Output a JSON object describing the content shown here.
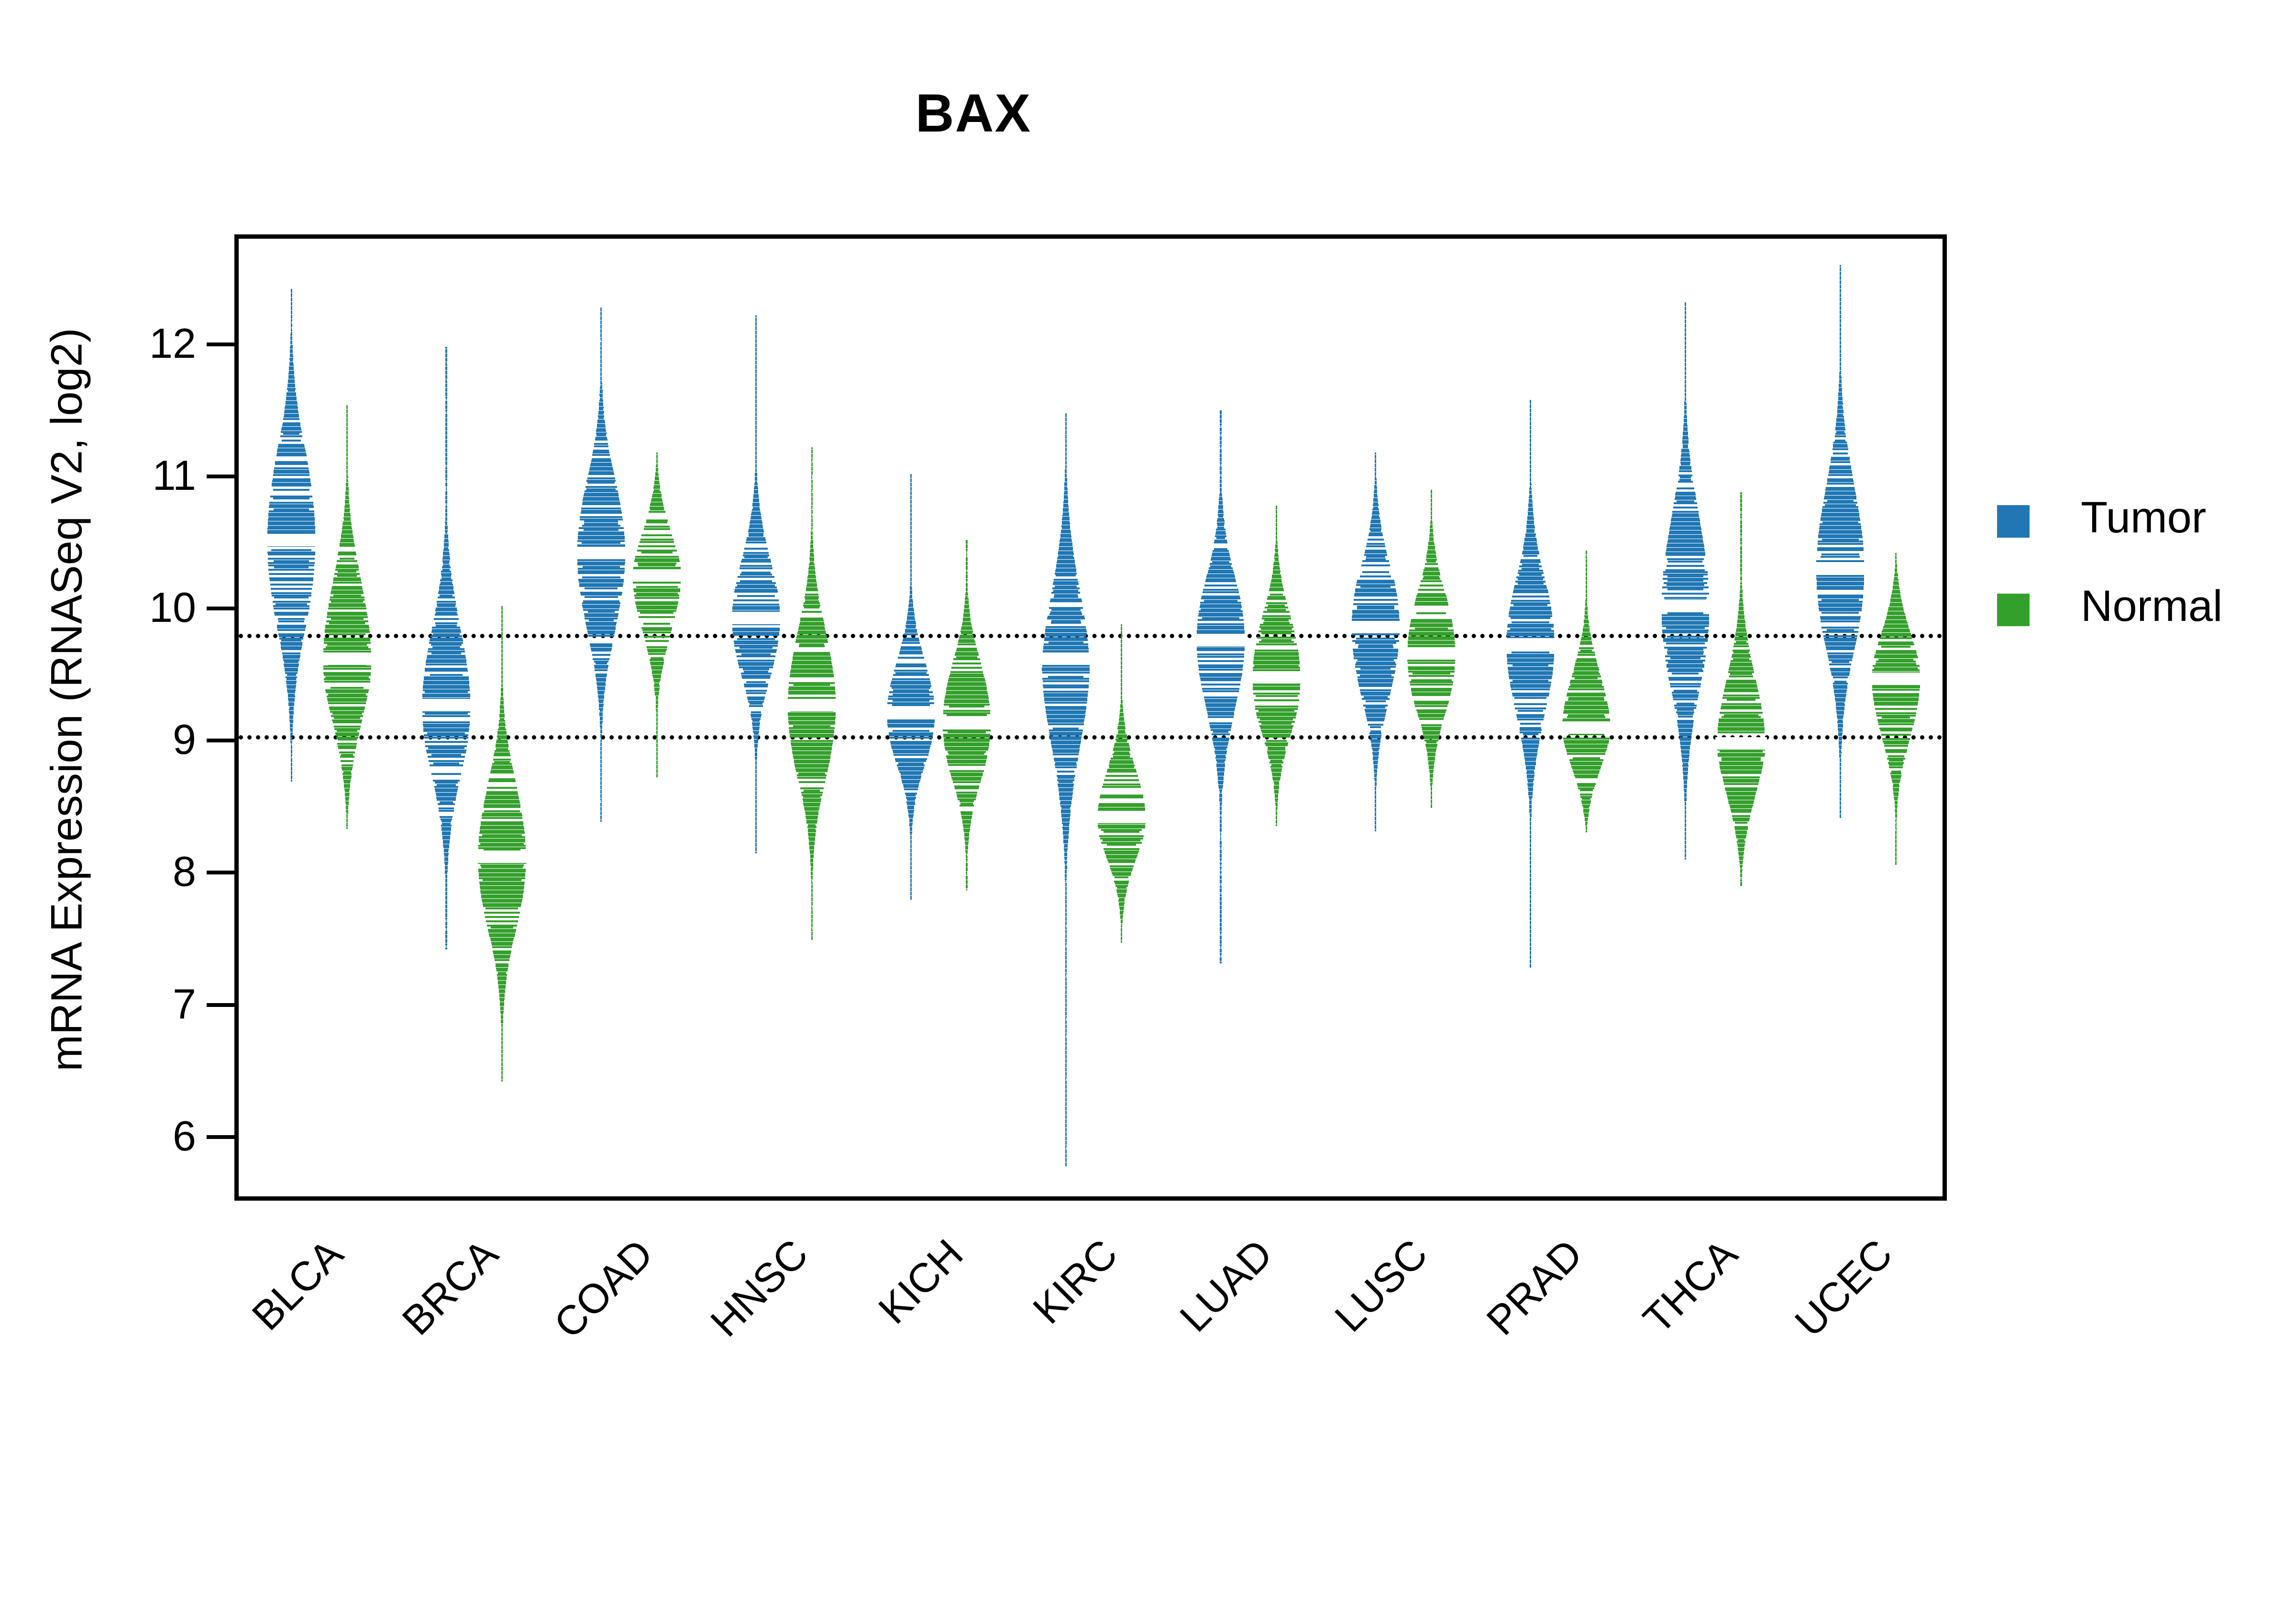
{
  "chart_data": {
    "type": "violin",
    "title": "BAX",
    "xlabel": "",
    "ylabel": "mRNA Expression (RNASeq V2, log2)",
    "ylim": [
      5.55,
      12.8
    ],
    "yticks": [
      6,
      7,
      8,
      9,
      10,
      11,
      12
    ],
    "ytick_labels": [
      "6",
      "7",
      "8",
      "9",
      "10",
      "11",
      "12"
    ],
    "grid": false,
    "legend_position": "right",
    "reference_lines": [
      9.81,
      9.04
    ],
    "categories": [
      "BLCA",
      "BRCA",
      "COAD",
      "HNSC",
      "KICH",
      "KIRC",
      "LUAD",
      "LUSC",
      "PRAD",
      "THCA",
      "UCEC"
    ],
    "series": [
      {
        "name": "Tumor",
        "color": "#2077b4",
        "medians": [
          10.52,
          9.27,
          10.42,
          9.93,
          9.21,
          9.62,
          9.76,
          9.86,
          9.73,
          10.02,
          10.3
        ],
        "q1": [
          10.1,
          8.92,
          10.1,
          9.68,
          8.99,
          9.24,
          9.48,
          9.56,
          9.43,
          9.63,
          9.95
        ],
        "q3": [
          10.92,
          9.62,
          10.78,
          10.22,
          9.46,
          10.02,
          10.1,
          10.18,
          10.06,
          10.42,
          10.7
        ],
        "min": [
          8.7,
          7.42,
          8.4,
          8.16,
          7.8,
          5.79,
          7.32,
          8.32,
          7.29,
          8.1,
          8.42
        ],
        "max": [
          12.42,
          11.98,
          12.28,
          12.22,
          11.02,
          11.48,
          11.5,
          11.18,
          11.58,
          12.32,
          12.6
        ]
      },
      {
        "name": "Normal",
        "color": "#34a02c",
        "medians": [
          9.62,
          8.12,
          10.25,
          9.27,
          9.14,
          8.42,
          9.48,
          9.66,
          9.1,
          8.98,
          9.47
        ],
        "q1": [
          9.3,
          7.8,
          10.02,
          8.96,
          8.86,
          8.22,
          9.22,
          9.4,
          8.9,
          8.66,
          9.24
        ],
        "q3": [
          10.0,
          8.46,
          10.52,
          9.62,
          9.4,
          8.66,
          9.78,
          9.96,
          9.38,
          9.26,
          9.76
        ],
        "min": [
          8.34,
          6.42,
          8.72,
          7.5,
          7.88,
          7.47,
          8.36,
          8.5,
          8.32,
          7.9,
          8.06
        ],
        "max": [
          11.54,
          10.02,
          11.18,
          11.22,
          10.52,
          9.88,
          10.78,
          10.9,
          10.44,
          10.88,
          10.42
        ]
      }
    ]
  },
  "legend": {
    "items": [
      {
        "label": "Tumor",
        "color": "#2077b4"
      },
      {
        "label": "Normal",
        "color": "#34a02c"
      }
    ]
  }
}
